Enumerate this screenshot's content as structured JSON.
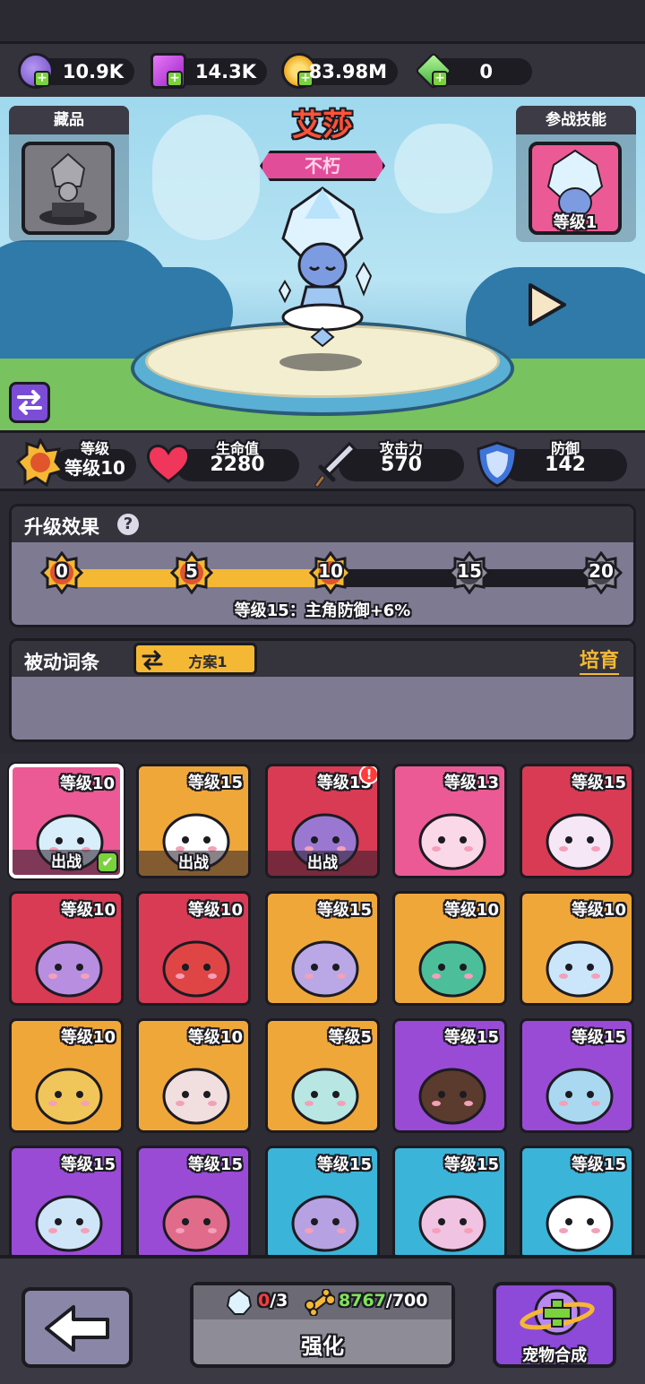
{
  "currencies": [
    {
      "name": "purple-potion",
      "value": "10.9K",
      "color": "#8a63d2"
    },
    {
      "name": "purple-cube",
      "value": "14.3K",
      "color": "#c23be0"
    },
    {
      "name": "gold-coin",
      "value": "83.98M",
      "color": "#f4b834"
    },
    {
      "name": "green-gem",
      "value": "0",
      "color": "#5bd64e"
    }
  ],
  "collection": {
    "title": "藏品"
  },
  "skill": {
    "title": "参战技能",
    "level": "等级1"
  },
  "hero": {
    "name": "艾莎",
    "rank": "不朽"
  },
  "stats": {
    "level": {
      "label": "等级",
      "value": "等级10"
    },
    "hp": {
      "label": "生命值",
      "value": "2280"
    },
    "attack": {
      "label": "攻击力",
      "value": "570"
    },
    "defense": {
      "label": "防御",
      "value": "142"
    }
  },
  "upgrade_effect": {
    "title": "升级效果",
    "help_icon": "?",
    "milestones": [
      "0",
      "5",
      "10",
      "15",
      "20"
    ],
    "current_level": 10,
    "max_level": 20,
    "next_bonus": "等级15：主角防御+6%"
  },
  "passive": {
    "title": "被动词条",
    "plan_label": "方案1",
    "nurture_label": "培育"
  },
  "pets": [
    {
      "level": "等级10",
      "deploy": "出战",
      "checked": true,
      "bg": "#ec5a95",
      "art": "#d9eefb",
      "selected": true
    },
    {
      "level": "等级15",
      "deploy": "出战",
      "checked": false,
      "bg": "#f0a73a",
      "art": "#ffffff"
    },
    {
      "level": "等级15",
      "deploy": "出战",
      "checked": false,
      "bg": "#d93b54",
      "art": "#9a78d2",
      "alert": true
    },
    {
      "level": "等级13",
      "bg": "#ec5a95",
      "art": "#fbd8e8"
    },
    {
      "level": "等级15",
      "bg": "#d93b54",
      "art": "#f5e7f5"
    },
    {
      "level": "等级10",
      "bg": "#d93b54",
      "art": "#b88ee0"
    },
    {
      "level": "等级10",
      "bg": "#d93b54",
      "art": "#e04545"
    },
    {
      "level": "等级15",
      "bg": "#f0a73a",
      "art": "#b9a7e6"
    },
    {
      "level": "等级10",
      "bg": "#f0a73a",
      "art": "#4cbf9a"
    },
    {
      "level": "等级10",
      "bg": "#f0a73a",
      "art": "#cbe6fa"
    },
    {
      "level": "等级10",
      "bg": "#f0a73a",
      "art": "#f0c55a"
    },
    {
      "level": "等级10",
      "bg": "#f0a73a",
      "art": "#f1dede"
    },
    {
      "level": "等级5",
      "bg": "#f0a73a",
      "art": "#b8e6e3"
    },
    {
      "level": "等级15",
      "bg": "#9a4bd6",
      "art": "#5a3b2e"
    },
    {
      "level": "等级15",
      "bg": "#9a4bd6",
      "art": "#a9d8f0"
    },
    {
      "level": "等级15",
      "bg": "#9a4bd6",
      "art": "#cfe5f8"
    },
    {
      "level": "等级15",
      "bg": "#9a4bd6",
      "art": "#e16b8a"
    },
    {
      "level": "等级15",
      "bg": "#3bb4d9",
      "art": "#b6a1e2"
    },
    {
      "level": "等级15",
      "bg": "#3bb4d9",
      "art": "#f0c3e2"
    },
    {
      "level": "等级15",
      "bg": "#3bb4d9",
      "art": "#ffffff"
    }
  ],
  "bottom": {
    "upgrade": {
      "label": "强化",
      "shard_count": "0",
      "shard_total": "/3",
      "bone_count": "8767",
      "bone_total": "/700"
    },
    "fuse_label": "宠物合成"
  }
}
